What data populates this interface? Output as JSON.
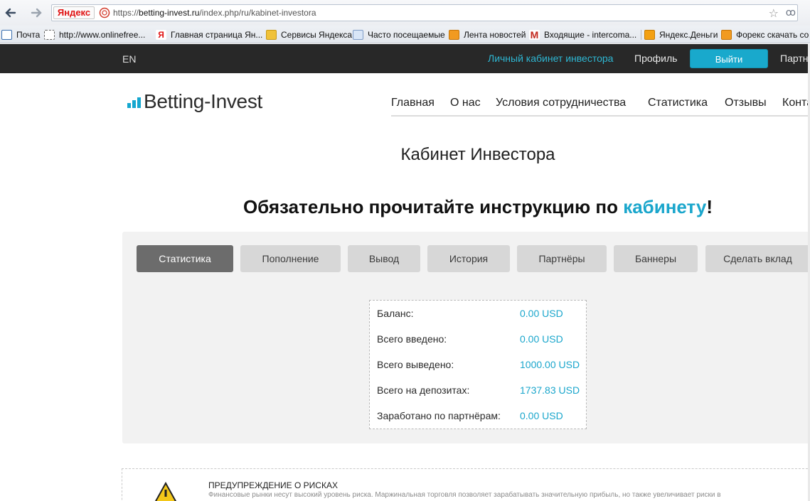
{
  "browser": {
    "yandex_badge": "Яндекс",
    "url_prefix": "https://",
    "url_host": "betting-invest.ru",
    "url_path": "/index.php/ru/kabinet-investora",
    "bookmarks": [
      {
        "label": "Почта",
        "icon": "mail-icon"
      },
      {
        "label": "http://www.onlinefree...",
        "icon": "page-icon"
      },
      {
        "label": "Главная страница Ян...",
        "icon": "yandex-icon"
      },
      {
        "label": "Сервисы Яндекса",
        "icon": "folder-icon"
      },
      {
        "label": "Часто посещаемые",
        "icon": "page-icon"
      },
      {
        "label": "Лента новостей",
        "icon": "rss-icon"
      },
      {
        "label": "Входящие - intercoma...",
        "icon": "gmail-icon"
      },
      {
        "label": "Яндекс.Деньги",
        "icon": "yandex-money-icon"
      },
      {
        "label": "Форекс скачать со",
        "icon": "rss-icon"
      }
    ]
  },
  "topbar": {
    "lang": "EN",
    "cabinet": "Личный кабинет инвестора",
    "profile": "Профиль",
    "logout": "Выйти",
    "partners": "Партн"
  },
  "logo": {
    "text": "Betting-Invest"
  },
  "nav": [
    {
      "label": "Главная"
    },
    {
      "label": "О нас"
    },
    {
      "label": "Условия сотрудничества"
    },
    {
      "label": "Статистика"
    },
    {
      "label": "Отзывы"
    },
    {
      "label": "Конта"
    }
  ],
  "page": {
    "title": "Кабинет Инвестора",
    "notice_before": "Обязательно прочитайте инструкцию по ",
    "notice_link": "кабинету",
    "notice_after": "!"
  },
  "tabs": [
    {
      "label": "Статистика",
      "active": true
    },
    {
      "label": "Пополнение",
      "active": false
    },
    {
      "label": "Вывод",
      "active": false
    },
    {
      "label": "История",
      "active": false
    },
    {
      "label": "Партнёры",
      "active": false
    },
    {
      "label": "Баннеры",
      "active": false
    },
    {
      "label": "Сделать вклад",
      "active": false
    }
  ],
  "stats": [
    {
      "label": "Баланс:",
      "value": "0.00 USD"
    },
    {
      "label": "Всего введено:",
      "value": "0.00 USD"
    },
    {
      "label": "Всего выведено:",
      "value": "1000.00 USD"
    },
    {
      "label": "Всего на депозитах:",
      "value": "1737.83 USD"
    },
    {
      "label": "Заработано по партнёрам:",
      "value": "0.00 USD"
    }
  ],
  "risk": {
    "title": "ПРЕДУПРЕЖДЕНИЕ О РИСКАХ",
    "text": "Финансовые рынки несут высокий уровень риска. Маржинальная торговля позволяет зарабатывать значительную прибыль, но также увеличивает риски в"
  },
  "colors": {
    "accent": "#1aa6cc",
    "topbar": "#282828",
    "active_tab": "#6c6c6c"
  }
}
